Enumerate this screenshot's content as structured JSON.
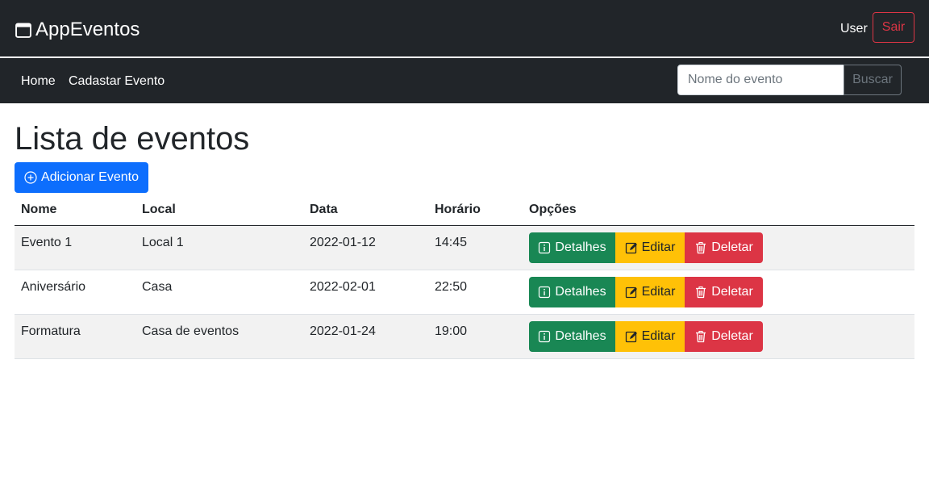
{
  "header": {
    "brand": "AppEventos",
    "user": "User",
    "logout_label": "Sair"
  },
  "nav": {
    "home": "Home",
    "register_event": "Cadastar Evento",
    "search_placeholder": "Nome do evento",
    "search_button": "Buscar"
  },
  "main": {
    "title": "Lista de eventos",
    "add_button": "Adicionar Evento",
    "table": {
      "columns": [
        "Nome",
        "Local",
        "Data",
        "Horário",
        "Opções"
      ],
      "rows": [
        {
          "nome": "Evento 1",
          "local": "Local 1",
          "data": "2022-01-12",
          "horario": "14:45"
        },
        {
          "nome": "Aniversário",
          "local": "Casa",
          "data": "2022-02-01",
          "horario": "22:50"
        },
        {
          "nome": "Formatura",
          "local": "Casa de eventos",
          "data": "2022-01-24",
          "horario": "19:00"
        }
      ],
      "actions": {
        "details": "Detalhes",
        "edit": "Editar",
        "delete": "Deletar"
      }
    }
  },
  "colors": {
    "navbar": "#212529",
    "primary": "#0d6efd",
    "success": "#198754",
    "warning": "#ffc107",
    "danger": "#dc3545"
  }
}
